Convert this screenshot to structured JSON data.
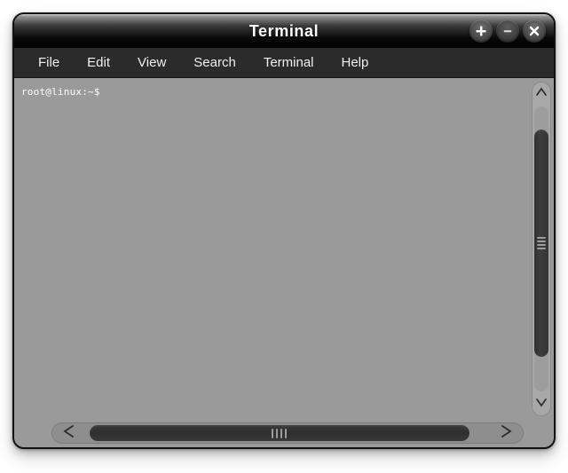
{
  "window": {
    "title": "Terminal",
    "controls": [
      {
        "name": "maximize-button",
        "icon": "plus-icon",
        "label": "+"
      },
      {
        "name": "minimize-button",
        "icon": "minus-icon",
        "label": "−"
      },
      {
        "name": "close-button",
        "icon": "close-icon",
        "label": "×"
      }
    ]
  },
  "menubar": {
    "items": [
      {
        "label": "File"
      },
      {
        "label": "Edit"
      },
      {
        "label": "View"
      },
      {
        "label": "Search"
      },
      {
        "label": "Terminal"
      },
      {
        "label": "Help"
      }
    ]
  },
  "terminal": {
    "prompt": "root@linux:~$",
    "lines": [
      "root@linux:~$"
    ]
  },
  "scrollbars": {
    "vertical": {
      "up_arrow_icon": "chevron-up-icon",
      "down_arrow_icon": "chevron-down-icon",
      "thumb_grip_icon": "grip-horizontal-icon"
    },
    "horizontal": {
      "left_arrow_icon": "chevron-left-icon",
      "right_arrow_icon": "chevron-right-icon",
      "thumb_grip_icon": "grip-vertical-icon"
    }
  },
  "colors": {
    "titlebar": "#000000",
    "menubar": "#2b2b2b",
    "terminal_background": "#9a9a9a",
    "terminal_text": "#ffffff",
    "frame_border": "#121212",
    "scrollbar_thumb": "#333333",
    "desktop_background": "#ffffff"
  }
}
